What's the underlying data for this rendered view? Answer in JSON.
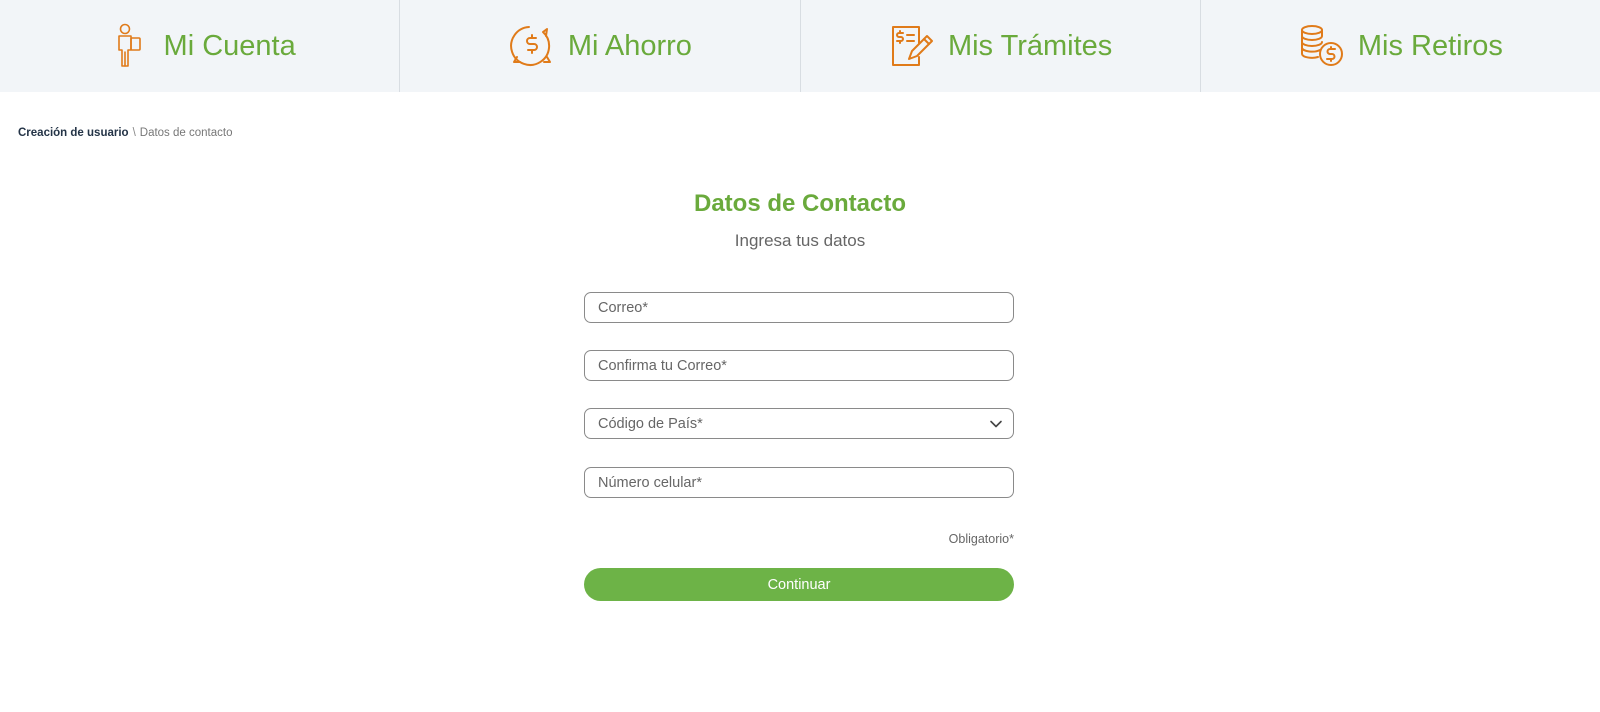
{
  "nav": {
    "items": [
      {
        "label": "Mi Cuenta",
        "icon": "person-icon"
      },
      {
        "label": "Mi Ahorro",
        "icon": "piggy-bank-icon"
      },
      {
        "label": "Mis Trámites",
        "icon": "document-pen-icon"
      },
      {
        "label": "Mis Retiros",
        "icon": "coins-icon"
      }
    ],
    "icon_color": "#e07b1a",
    "label_color": "#6aaa3c"
  },
  "breadcrumb": {
    "root": "Creación de usuario",
    "separator": "\\",
    "current": "Datos de contacto"
  },
  "page": {
    "title": "Datos de Contacto",
    "subtitle": "Ingresa tus datos"
  },
  "form": {
    "email_placeholder": "Correo*",
    "confirm_email_placeholder": "Confirma tu Correo*",
    "country_code_selected": "Código de País*",
    "phone_placeholder": "Número celular*",
    "required_note": "Obligatorio*",
    "submit_label": "Continuar"
  },
  "colors": {
    "accent_green": "#6db347",
    "accent_orange": "#e07b1a",
    "nav_background": "#f2f5f8"
  }
}
